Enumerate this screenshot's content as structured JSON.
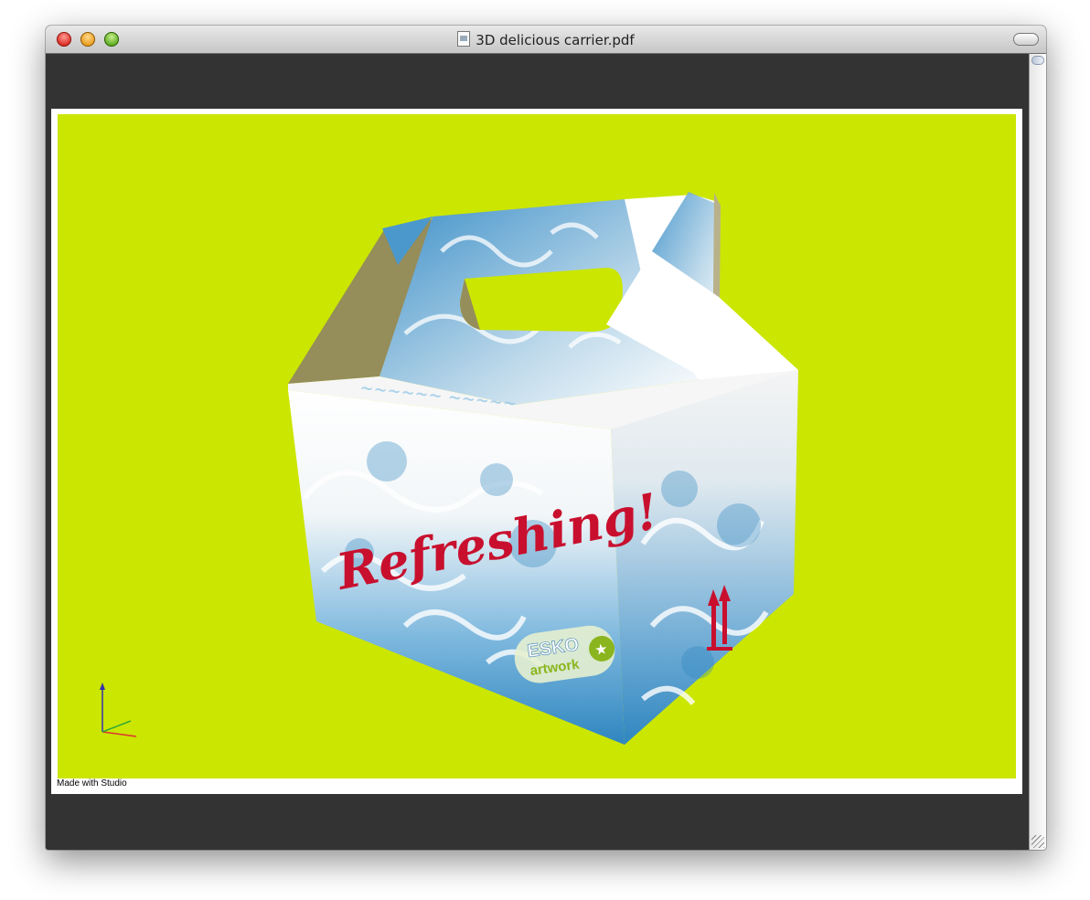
{
  "window": {
    "title": "3D delicious carrier.pdf"
  },
  "document": {
    "footer_text": "Made with Studio",
    "viewport_background": "#cbe600",
    "box": {
      "slogan": "Refreshing!",
      "brand_top": "ESKO",
      "brand_bottom": "artwork",
      "accent_color": "#c8102e",
      "pattern_color": "#3f93c9"
    }
  },
  "icons": {
    "traffic_lights": [
      "close-icon",
      "minimize-icon",
      "zoom-icon"
    ],
    "document": "pdf-document-icon",
    "axes": "3d-axes-icon"
  }
}
